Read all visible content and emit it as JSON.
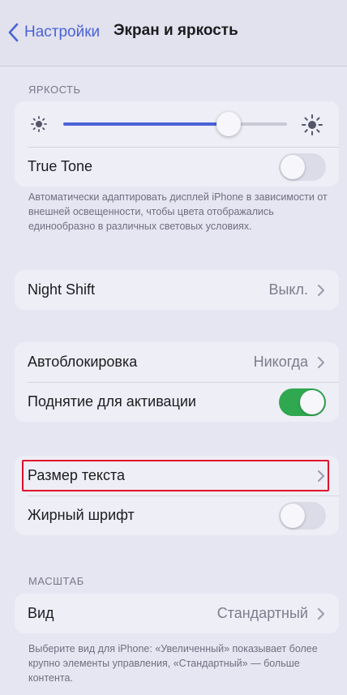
{
  "navbar": {
    "back_label": "Настройки",
    "title": "Экран и яркость"
  },
  "brightness": {
    "header": "ЯРКОСТЬ",
    "level": 0.74,
    "true_tone_label": "True Tone",
    "true_tone_on": false,
    "footnote": "Автоматически адаптировать дисплей iPhone в зависимости от внешней освещенности, чтобы цвета отображались единообразно в различных световых условиях."
  },
  "night_shift": {
    "label": "Night Shift",
    "value": "Выкл."
  },
  "lock": {
    "auto_lock_label": "Автоблокировка",
    "auto_lock_value": "Никогда",
    "raise_to_wake_label": "Поднятие для активации",
    "raise_to_wake_on": true
  },
  "text": {
    "text_size_label": "Размер текста",
    "bold_text_label": "Жирный шрифт",
    "bold_text_on": false
  },
  "zoom": {
    "header": "МАСШТАБ",
    "view_label": "Вид",
    "view_value": "Стандартный",
    "footnote": "Выберите вид для iPhone: «Увеличенный» показывает более крупно элементы управления, «Стандартный» — больше контента."
  },
  "colors": {
    "accent": "#4a63d6",
    "toggle_on": "#2fa84f",
    "highlight": "#e0102a"
  }
}
